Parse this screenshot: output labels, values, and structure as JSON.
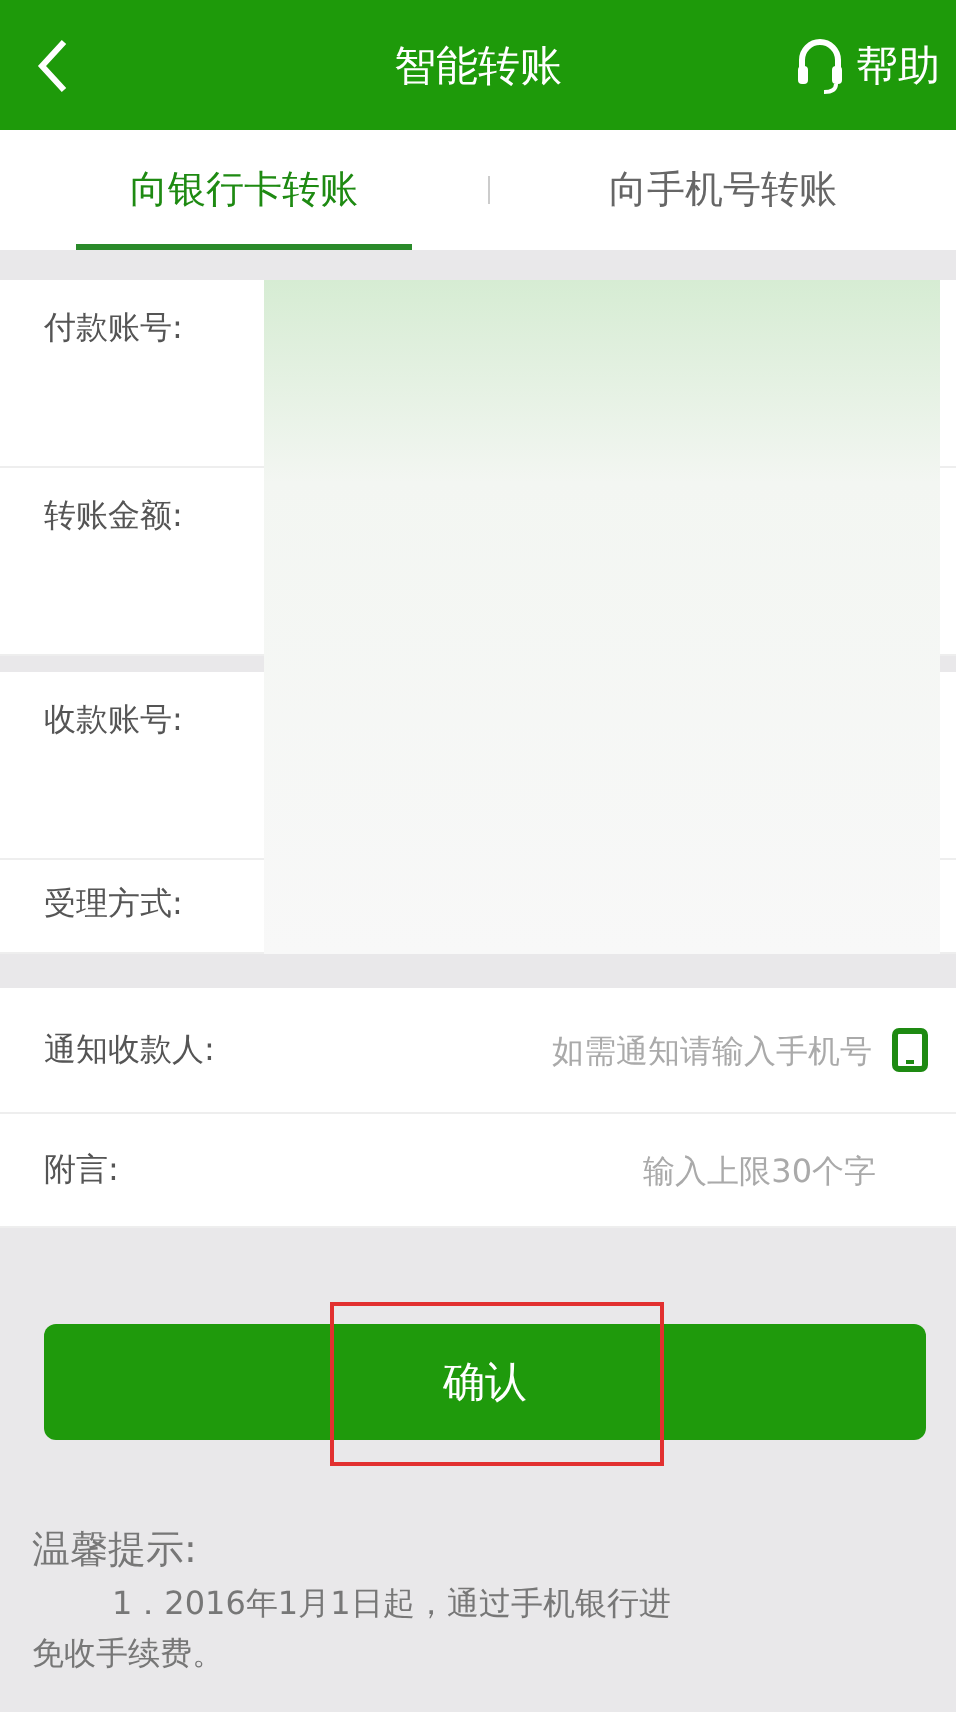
{
  "header": {
    "title": "智能转账",
    "help": "帮助"
  },
  "tabs": [
    {
      "label": "向银行卡转账",
      "selected": true
    },
    {
      "label": "向手机号转账",
      "selected": false
    }
  ],
  "account_section": {
    "groups": [
      {
        "rows": [
          {
            "label": "付款账号:",
            "kind": "tall"
          },
          {
            "label": "转账金额:",
            "kind": "tall"
          }
        ]
      },
      {
        "rows": [
          {
            "label": "收款账号:",
            "kind": "tall"
          },
          {
            "label": "受理方式:",
            "kind": "short"
          }
        ]
      }
    ]
  },
  "extra_fields": [
    {
      "label": "通知收款人:",
      "placeholder": "如需通知请输入手机号",
      "kind": "phone"
    },
    {
      "label": "附言:",
      "placeholder": "输入上限30个字",
      "kind": "text"
    }
  ],
  "confirm_button": {
    "label": "确认",
    "highlighted": true
  },
  "tips": {
    "title": "温馨提示:",
    "lines": [
      "1．2016年1月1日起，通过手机银行进",
      "免收手续费。"
    ]
  }
}
